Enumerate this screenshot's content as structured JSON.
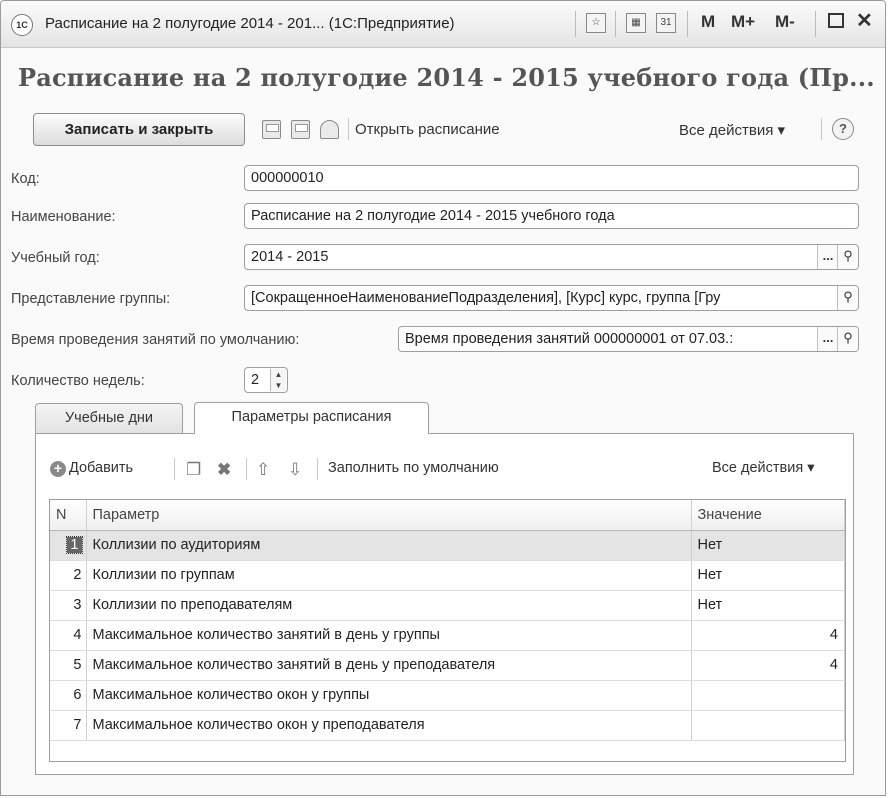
{
  "window": {
    "title": "Расписание на 2 полугодие 2014 - 201... (1С:Предприятие)",
    "logo": "1С",
    "m_buttons": [
      "M",
      "M+",
      "M-"
    ]
  },
  "heading": "Расписание на 2 полугодие 2014 - 2015 учебного года (Пр...",
  "toolbar": {
    "save_close": "Записать и закрыть",
    "open_schedule": "Открыть расписание",
    "all_actions": "Все действия ▾",
    "help": "?"
  },
  "form": {
    "code": {
      "label": "Код:",
      "value": "000000010"
    },
    "name": {
      "label": "Наименование:",
      "value": "Расписание на 2 полугодие 2014 - 2015 учебного года"
    },
    "year": {
      "label": "Учебный год:",
      "value": "2014 - 2015"
    },
    "group_repr": {
      "label": "Представление группы:",
      "value": "[СокращенноеНаименованиеПодразделения], [Курс] курс, группа [Гру"
    },
    "default_time": {
      "label": "Время проведения занятий по умолчанию:",
      "value": "Время проведения занятий 000000001 от 07.03.:"
    },
    "weeks": {
      "label": "Количество недель:",
      "value": "2"
    }
  },
  "tabs": {
    "days": "Учебные дни",
    "params": "Параметры расписания"
  },
  "params_toolbar": {
    "add": "Добавить",
    "fill_default": "Заполнить по умолчанию",
    "all_actions": "Все действия ▾"
  },
  "grid": {
    "headers": {
      "n": "N",
      "param": "Параметр",
      "value": "Значение"
    },
    "rows": [
      {
        "n": "1",
        "param": "Коллизии по аудиториям",
        "value": "Нет"
      },
      {
        "n": "2",
        "param": "Коллизии по группам",
        "value": "Нет"
      },
      {
        "n": "3",
        "param": "Коллизии по преподавателям",
        "value": "Нет"
      },
      {
        "n": "4",
        "param": "Максимальное количество занятий в день у группы",
        "value": "4"
      },
      {
        "n": "5",
        "param": "Максимальное количество занятий в день у преподавателя",
        "value": "4"
      },
      {
        "n": "6",
        "param": "Максимальное количество окон у группы",
        "value": ""
      },
      {
        "n": "7",
        "param": "Максимальное количество окон у преподавателя",
        "value": ""
      }
    ]
  }
}
